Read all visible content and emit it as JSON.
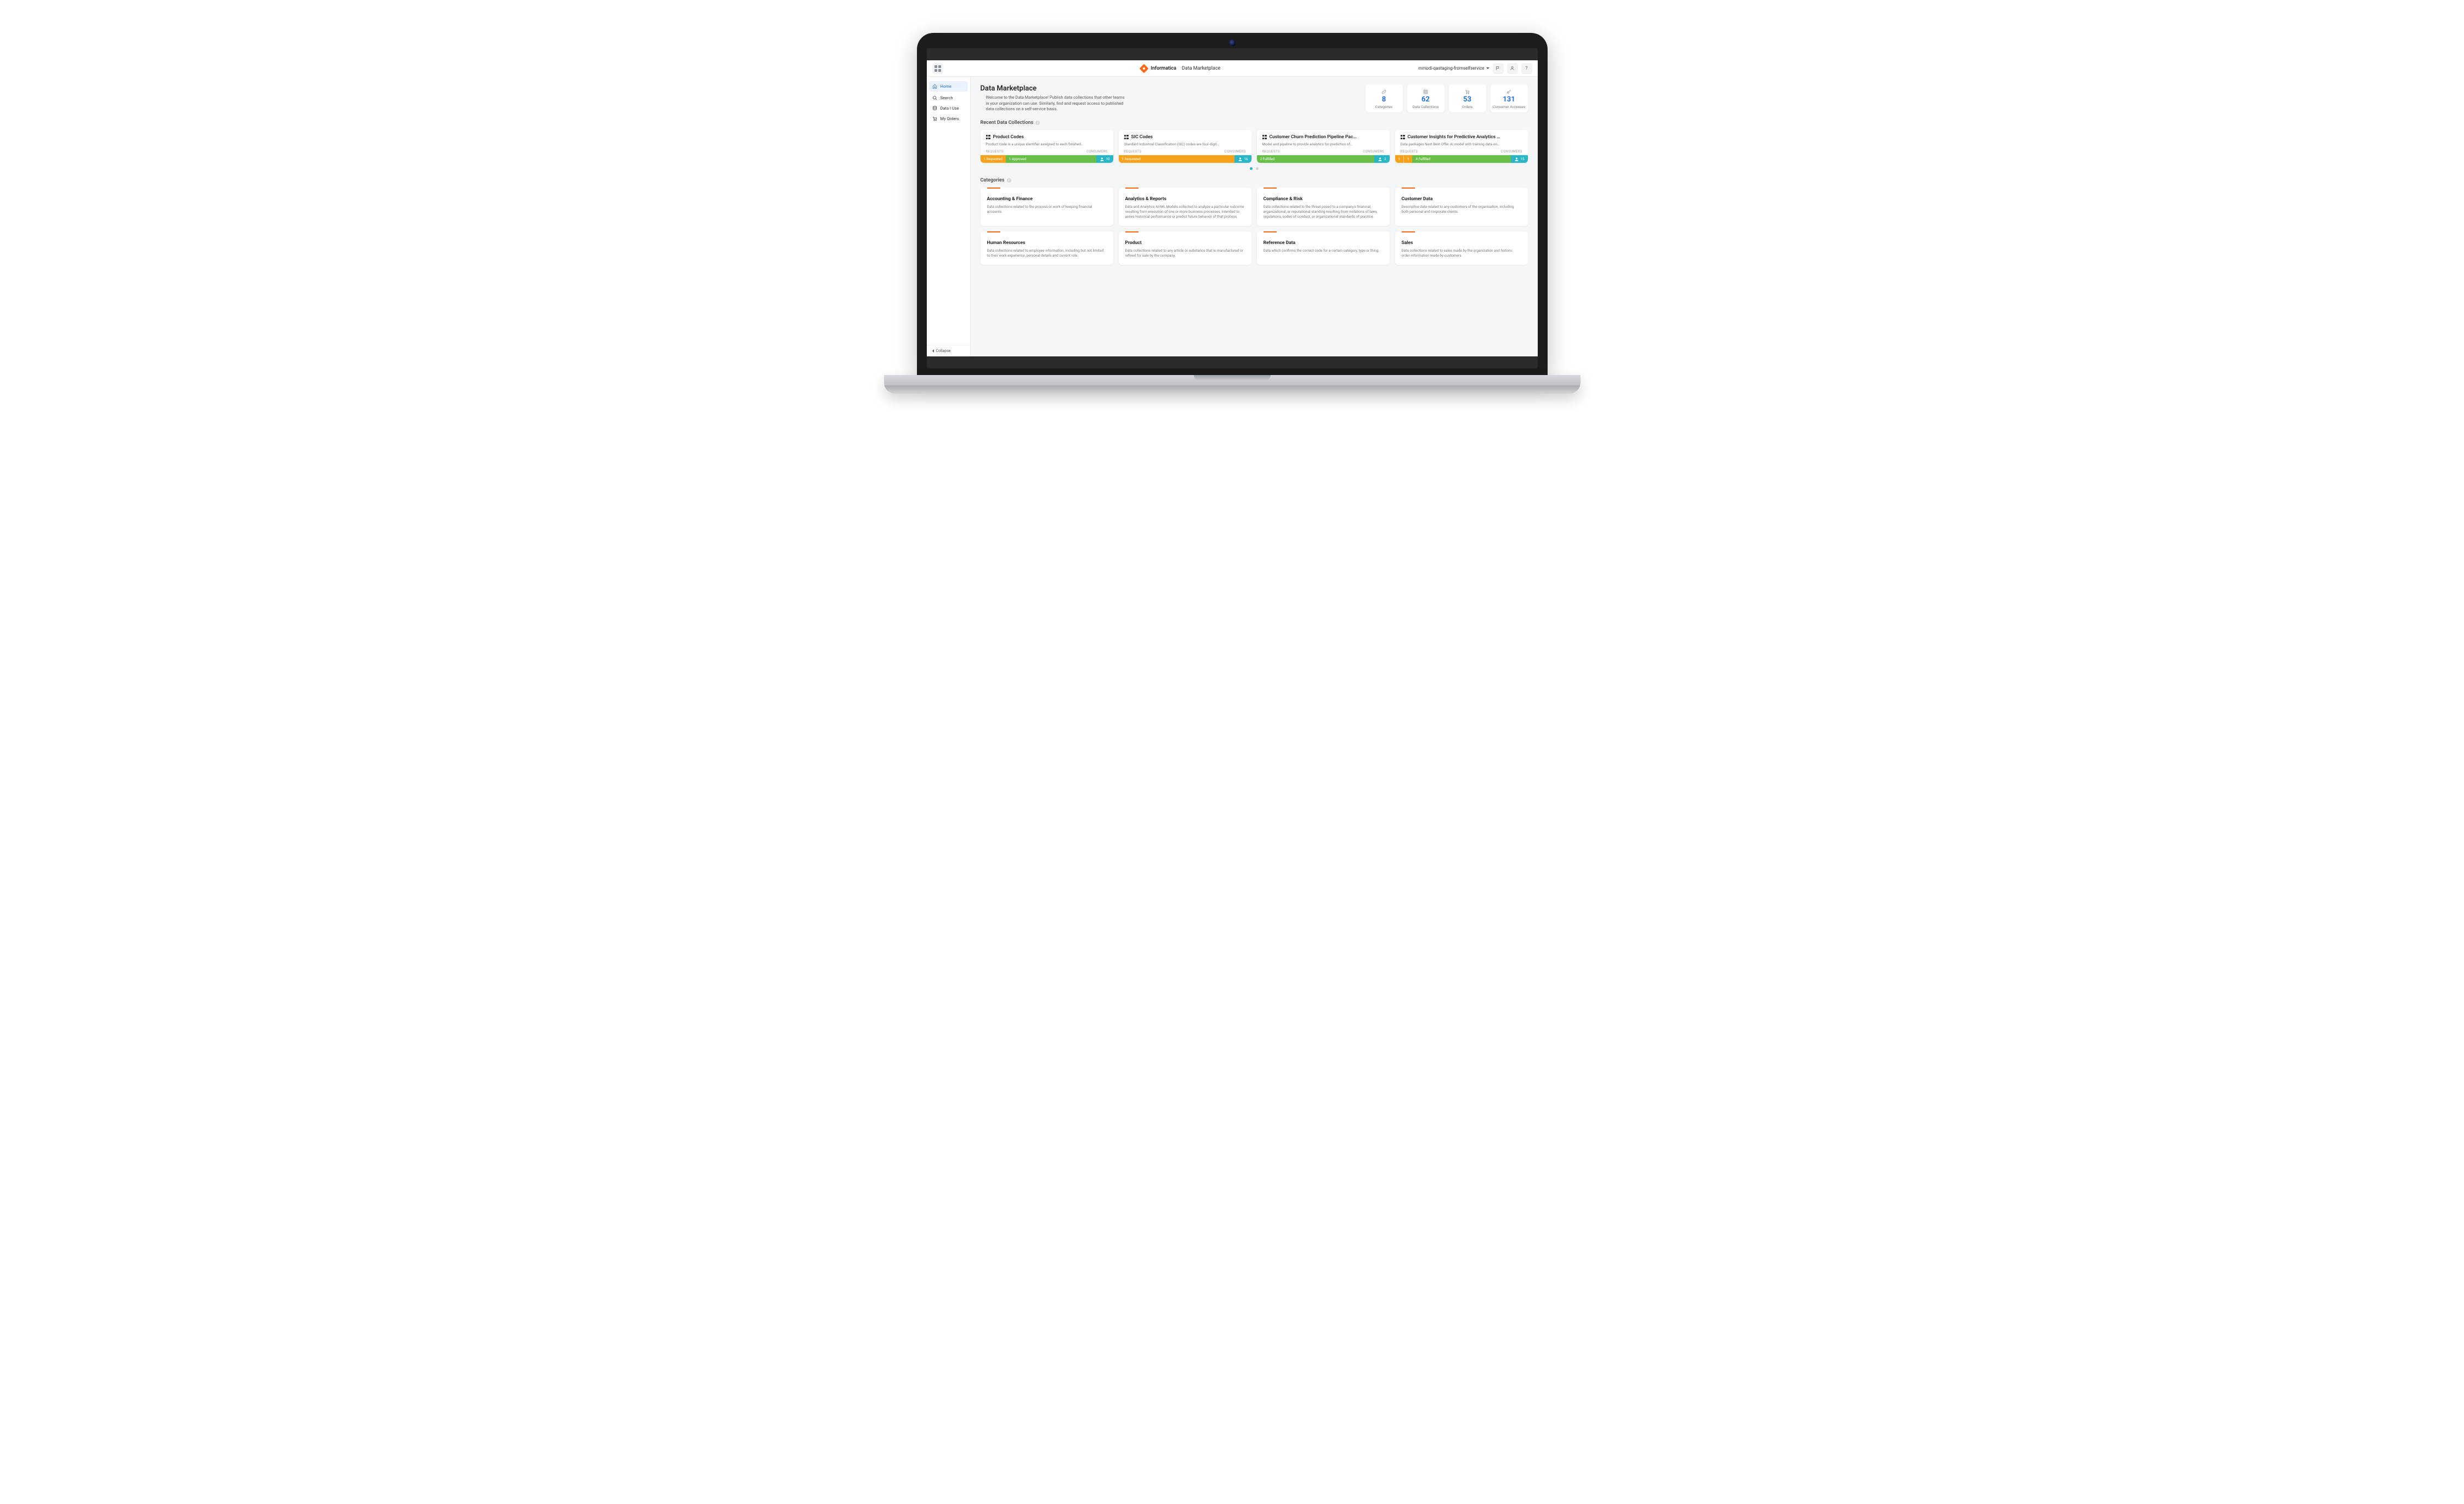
{
  "header": {
    "brand": "Informatica",
    "product": "Data Marketplace",
    "user": "mmodi-qastaging-fromselfservice"
  },
  "sidebar": {
    "items": [
      {
        "label": "Home"
      },
      {
        "label": "Search"
      },
      {
        "label": "Data I Use"
      },
      {
        "label": "My Orders"
      }
    ],
    "collapse": "Collapse"
  },
  "intro": {
    "title": "Data Marketplace",
    "text": "Welcome to the Data Marketplace! Publish data collections that other teams in your organization can use. Similarly, find and request access to published data collections on a self-service basis."
  },
  "stats": [
    {
      "value": "8",
      "label": "Categories"
    },
    {
      "value": "62",
      "label": "Data Collections"
    },
    {
      "value": "53",
      "label": "Orders"
    },
    {
      "value": "131",
      "label": "Consumer Accesses"
    }
  ],
  "sections": {
    "recent": "Recent Data Collections",
    "categories": "Categories",
    "requests": "REQUESTS",
    "consumers": "CONSUMERS"
  },
  "collections": [
    {
      "title": "Product Codes",
      "desc": "Product code is a unique identifier assigned to each finished…",
      "bars": [
        {
          "cls": "orange",
          "text": "1 Requested"
        },
        {
          "cls": "green",
          "text": "1 Approved"
        }
      ],
      "consumers": "10"
    },
    {
      "title": "SIC Codes",
      "desc": "Standard Industrial Classification (SIC) codes are four-digit…",
      "bars": [
        {
          "cls": "orange",
          "text": "1 Requested"
        }
      ],
      "consumers": "16"
    },
    {
      "title": "Customer Churn Prediction Pipeline Pac…",
      "desc": "Model and pipeline to provide analytics for prediction of…",
      "bars": [
        {
          "cls": "green",
          "text": "2 Fulfilled"
        }
      ],
      "consumers": "2"
    },
    {
      "title": "Customer Insights for Predictive Analytics …",
      "desc": "Data packages Next Best Offer AI model with training data on…",
      "bars": [
        {
          "cls": "orange",
          "text": "1"
        },
        {
          "cls": "orange",
          "text": "1"
        },
        {
          "cls": "green",
          "text": "4 Fulfilled"
        }
      ],
      "consumers": "15"
    }
  ],
  "categories": [
    {
      "title": "Accounting & Finance",
      "desc": "Data collections related to the process or work of keeping financial accounts."
    },
    {
      "title": "Analytics & Reports",
      "desc": "Data and Analytics AI/ML Models collected to analyze a particular outcome resulting from execution of one or more business processes, intended to asses historical performance or predict future behavior of that process."
    },
    {
      "title": "Compliance & Risk",
      "desc": "Data collections related to the threat posed to a company's financial, organizational, or reputational standing resulting from violations of laws, regulations, codes of conduct, or organizational standards of practice."
    },
    {
      "title": "Customer Data",
      "desc": "Descriptive data related to any customers of the organisation, including both personal and corporate clients."
    },
    {
      "title": "Human Resources",
      "desc": "Data collections related to employee information, including but not limited to their work experience, personal details and current role."
    },
    {
      "title": "Product",
      "desc": "Data collections related to any article or substance that is manufactured or refined for sale by the company."
    },
    {
      "title": "Reference Data",
      "desc": "Data which confirms the correct code for a certain category, type or thing."
    },
    {
      "title": "Sales",
      "desc": "Data collections related to sales made by the organization and historic order information made by customers."
    }
  ]
}
